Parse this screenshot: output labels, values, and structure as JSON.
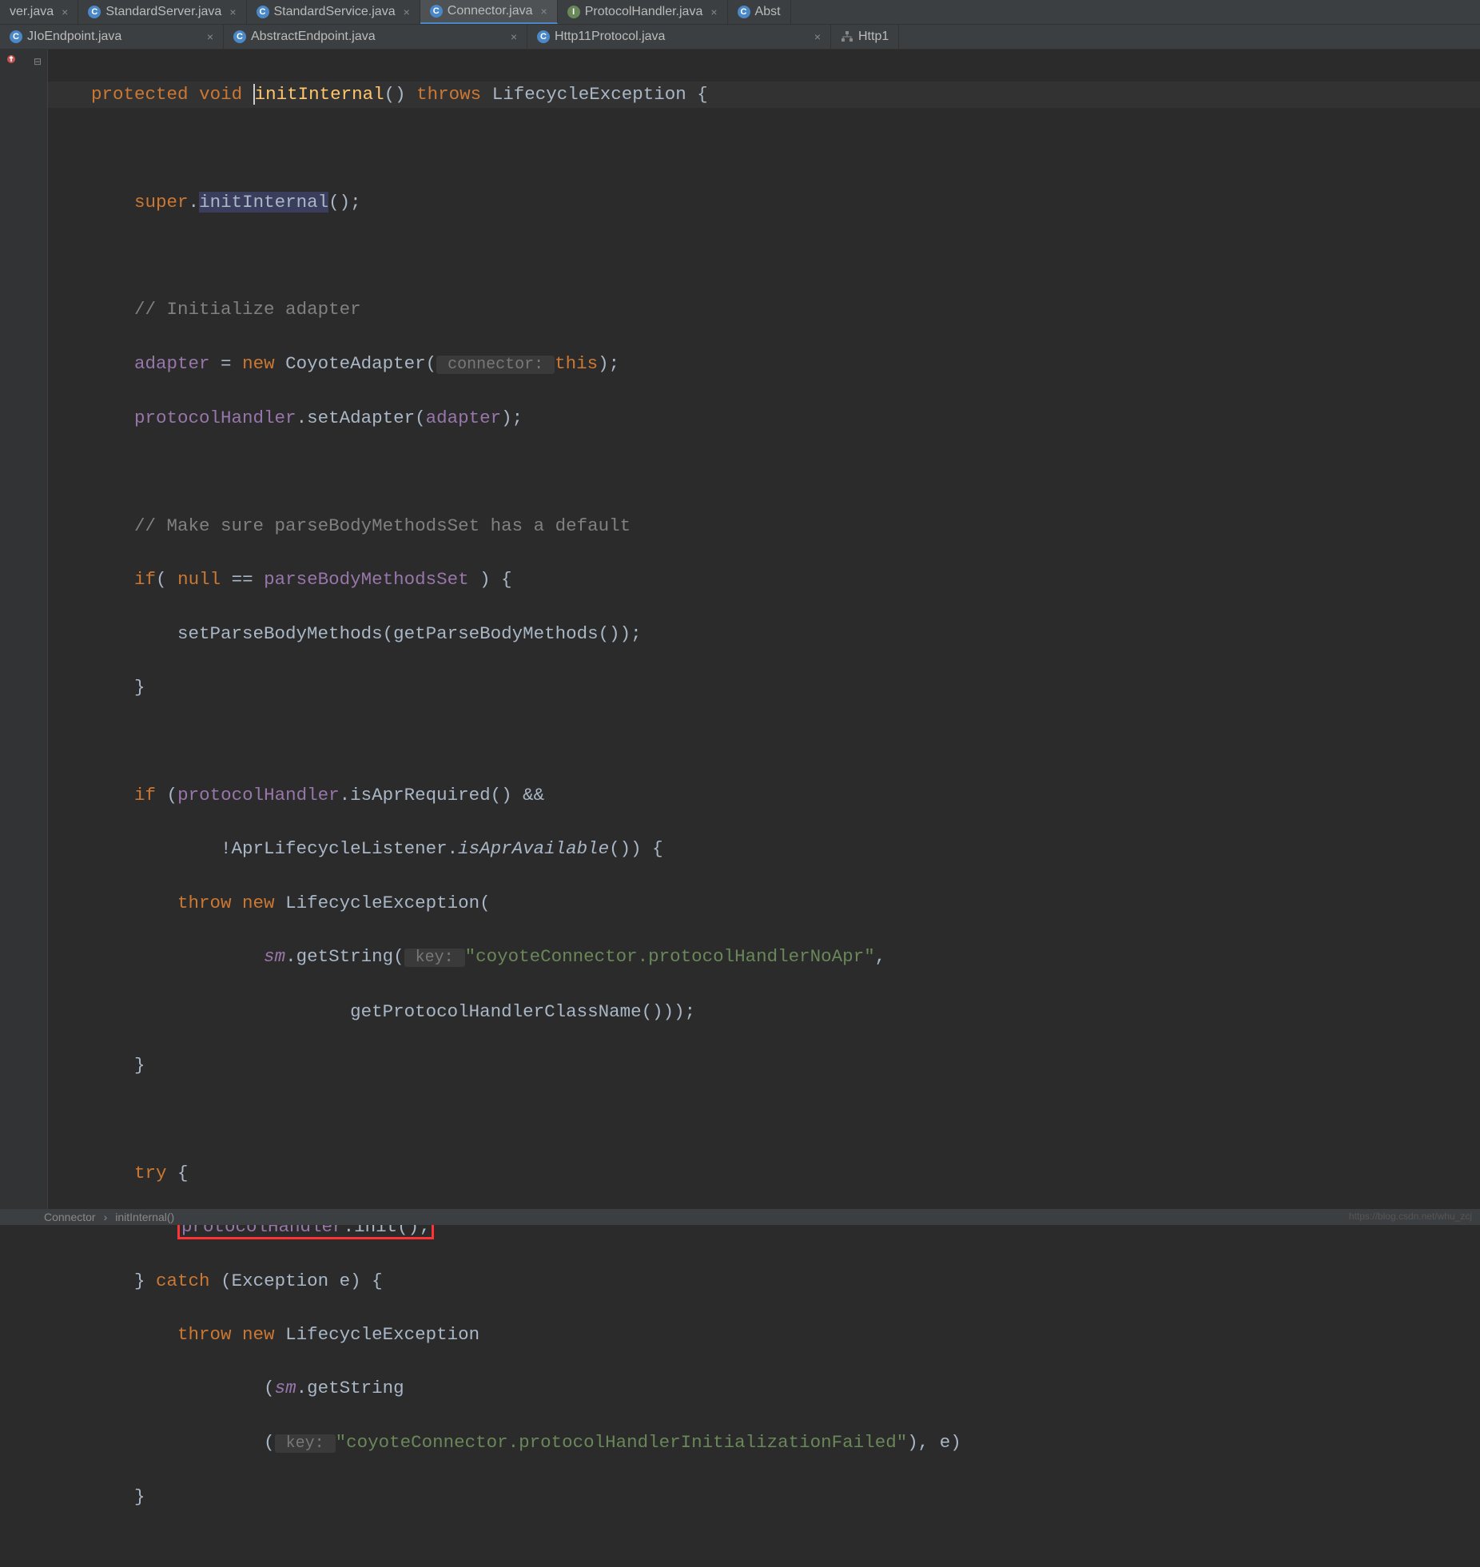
{
  "tabs_row1": [
    {
      "label": "ver.java",
      "icon": "none",
      "close": true,
      "active": false
    },
    {
      "label": "StandardServer.java",
      "icon": "c",
      "close": true,
      "active": false
    },
    {
      "label": "StandardService.java",
      "icon": "c",
      "close": true,
      "active": false
    },
    {
      "label": "Connector.java",
      "icon": "c",
      "close": true,
      "active": true
    },
    {
      "label": "ProtocolHandler.java",
      "icon": "i",
      "close": true,
      "active": false
    },
    {
      "label": "Abst",
      "icon": "c",
      "close": false,
      "active": false
    }
  ],
  "tabs_row2": [
    {
      "label": "JIoEndpoint.java",
      "icon": "c",
      "close": true,
      "active": false
    },
    {
      "label": "AbstractEndpoint.java",
      "icon": "c",
      "close": true,
      "active": false
    },
    {
      "label": "Http11Protocol.java",
      "icon": "c",
      "close": true,
      "active": false
    },
    {
      "label": "Http1",
      "icon": "struct",
      "close": false,
      "active": false
    }
  ],
  "code": {
    "l1_protected": "protected",
    "l1_void": "void",
    "l1_method": "initInternal",
    "l1_parens": "()",
    "l1_throws": "throws",
    "l1_exc": "LifecycleException",
    "l1_brace": "{",
    "l3_super": "super",
    "l3_dot": ".",
    "l3_call": "initInternal",
    "l3_end": "();",
    "l5_comment": "// Initialize adapter",
    "l6_adapter": "adapter",
    "l6_eq": " = ",
    "l6_new": "new",
    "l6_class": " CoyoteAdapter(",
    "l6_hint": " connector: ",
    "l6_this": "this",
    "l6_end": ");",
    "l7_ph": "protocolHandler",
    "l7_rest": ".setAdapter(",
    "l7_arg": "adapter",
    "l7_end": ");",
    "l9_comment": "// Make sure parseBodyMethodsSet has a default",
    "l10_if": "if",
    "l10_open": "( ",
    "l10_null": "null",
    "l10_eq": " == ",
    "l10_field": "parseBodyMethodsSet",
    "l10_close": " ) {",
    "l11_call": "setParseBodyMethods(getParseBodyMethods());",
    "l12_brace": "}",
    "l14_if": "if",
    "l14_open": " (",
    "l14_ph": "protocolHandler",
    "l14_rest": ".isAprRequired() &&",
    "l15_text1": "!AprLifecycleListener.",
    "l15_italic": "isAprAvailable",
    "l15_text2": "()) {",
    "l16_throw": "throw",
    "l16_new": " new",
    "l16_text": " LifecycleException(",
    "l17_sm": "sm",
    "l17_text": ".getString(",
    "l17_hint": " key: ",
    "l17_str": "\"coyoteConnector.protocolHandlerNoApr\"",
    "l17_comma": ",",
    "l18_text": "getProtocolHandlerClassName()));",
    "l19_brace": "}",
    "l21_try": "try",
    "l21_brace": " {",
    "l22_ph": "protocolHandler",
    "l22_call": ".init();",
    "l23_brace": "} ",
    "l23_catch": "catch",
    "l23_text": " (Exception e) {",
    "l24_throw": "throw",
    "l24_new": " new",
    "l24_text": " LifecycleException",
    "l25_open": "(",
    "l25_sm": "sm",
    "l25_text": ".getString",
    "l26_open": "(",
    "l26_hint": " key: ",
    "l26_str": "\"coyoteConnector.protocolHandlerInitializationFailed\"",
    "l26_text": "), e)",
    "l27_brace": "}"
  },
  "breadcrumb": {
    "class": "Connector",
    "sep": "›",
    "method": "initInternal()"
  },
  "watermark": "https://blog.csdn.net/whu_zcj"
}
